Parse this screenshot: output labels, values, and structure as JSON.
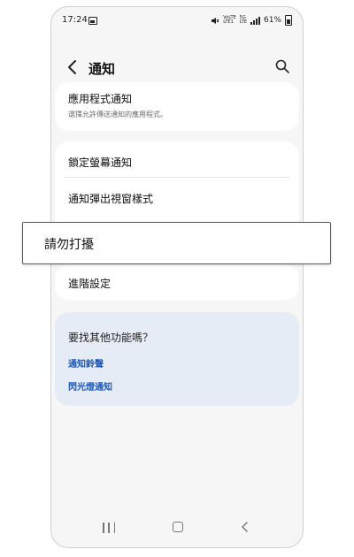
{
  "status": {
    "time": "17:24",
    "carrier_top": "VoLTE",
    "carrier_bottom": "LTE1",
    "network_top": "5G",
    "network_bottom": "LTE",
    "battery": "61%"
  },
  "header": {
    "title": "通知"
  },
  "settings": {
    "app_notifications": {
      "title": "應用程式通知",
      "subtitle": "選擇允許傳送通知的應用程式。"
    },
    "lock_screen": "鎖定螢幕通知",
    "popup_style": "通知彈出視窗樣式",
    "advanced": "進階設定"
  },
  "suggestions": {
    "title": "要找其他功能嗎？",
    "links": [
      "通知鈴聲",
      "閃光燈通知"
    ]
  },
  "popup": {
    "label": "請勿打擾"
  },
  "colors": {
    "link": "#1e57b8",
    "suggest_bg": "#e5ecf5",
    "screen_bg": "#f6f6f7"
  }
}
